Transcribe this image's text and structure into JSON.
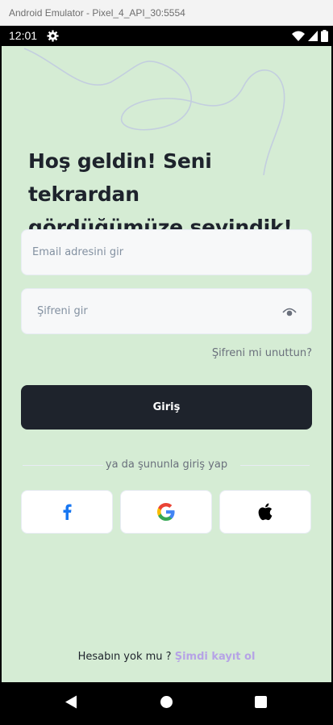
{
  "window": {
    "title": "Android Emulator - Pixel_4_API_30:5554"
  },
  "status_bar": {
    "time": "12:01"
  },
  "login": {
    "welcome_line1": "Hoş geldin! Seni tekrardan",
    "welcome_line2": "gördüğümüze sevindik!",
    "email_placeholder": "Email adresini gir",
    "password_placeholder": "Şifreni gir",
    "forgot_password": "Şifreni mi unuttun?",
    "login_button": "Giriş",
    "or_text": "ya da şununla giriş yap",
    "signup_prompt": "Hesabın yok mu ?",
    "signup_link": "Şimdi kayıt ol"
  },
  "social": [
    {
      "name": "facebook-icon",
      "color": "#1877f2"
    },
    {
      "name": "google-icon",
      "color": "#4285f4"
    },
    {
      "name": "apple-icon",
      "color": "#000000"
    }
  ],
  "colors": {
    "background": "#d5ecd4",
    "primary": "#1e232c",
    "link": "#b6a3e6"
  }
}
